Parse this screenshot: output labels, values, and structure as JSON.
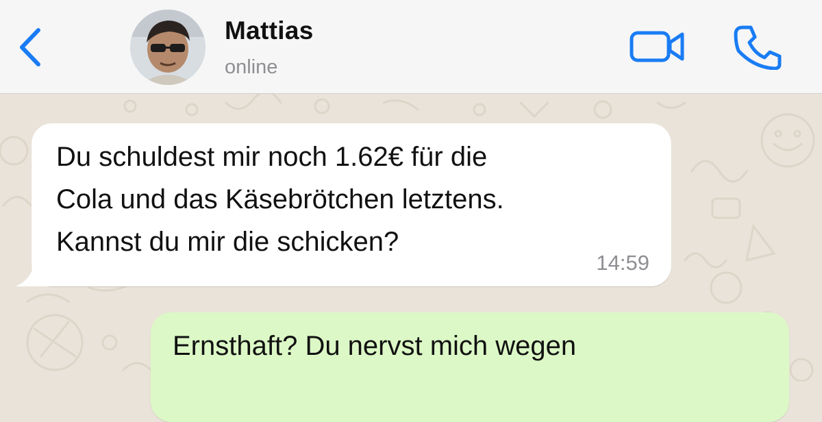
{
  "header": {
    "contact_name": "Mattias",
    "status": "online",
    "icons": {
      "back": "chevron-left-icon",
      "video": "video-camera-icon",
      "call": "phone-icon"
    },
    "accent_color": "#1a7cf4"
  },
  "messages": [
    {
      "direction": "incoming",
      "lines": [
        "Du schuldest mir noch 1.62€ für die",
        "Cola und das Käsebrötchen letztens.",
        "Kannst du mir die schicken?"
      ],
      "time": "14:59",
      "bubble_color": "#ffffff"
    },
    {
      "direction": "outgoing",
      "lines": [
        "Ernsthaft? Du nervst mich wegen"
      ],
      "bubble_color": "#dcf8c6"
    }
  ],
  "background_color": "#e9e3d9"
}
